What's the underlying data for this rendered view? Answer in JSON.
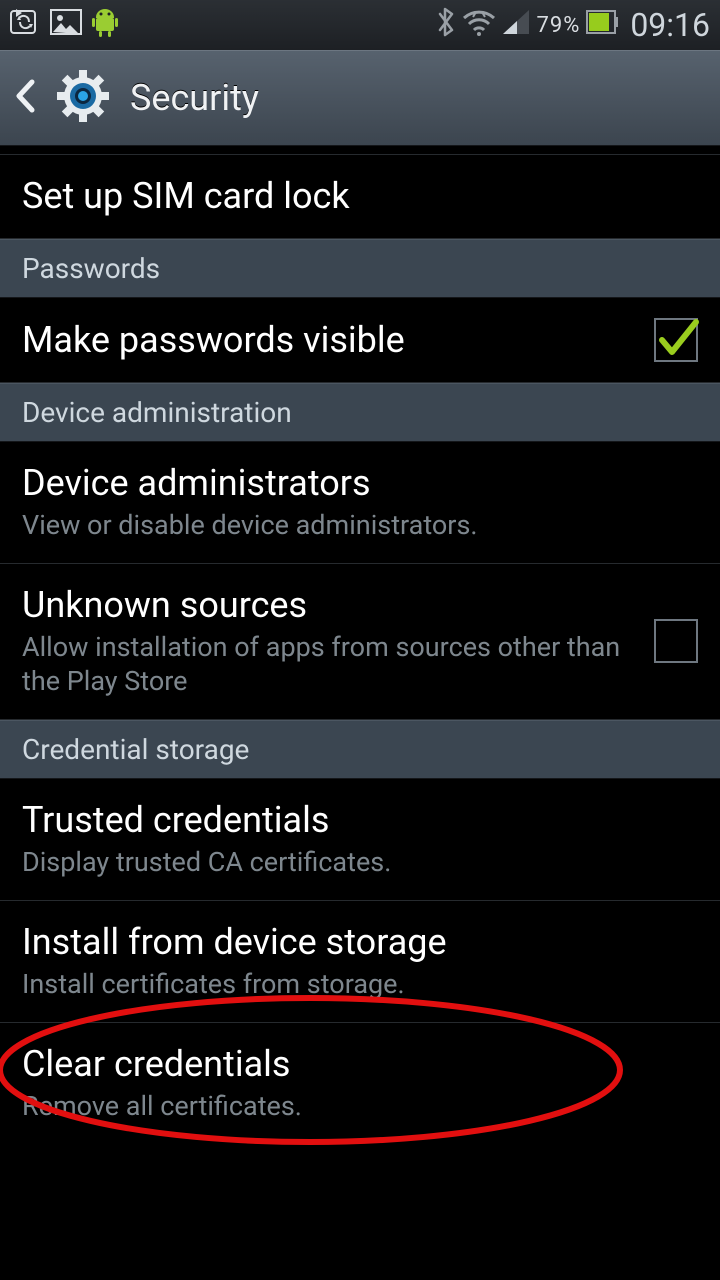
{
  "status": {
    "battery_pct": "79%",
    "time": "09:16"
  },
  "header": {
    "title": "Security"
  },
  "items": {
    "sim_lock": {
      "title": "Set up SIM card lock"
    },
    "section_passwords": "Passwords",
    "pw_visible": {
      "title": "Make passwords visible",
      "checked": true
    },
    "section_device_admin": "Device administration",
    "device_admins": {
      "title": "Device administrators",
      "sub": "View or disable device administrators."
    },
    "unknown_sources": {
      "title": "Unknown sources",
      "sub": "Allow installation of apps from sources other than the Play Store",
      "checked": false
    },
    "section_cred_storage": "Credential storage",
    "trusted_creds": {
      "title": "Trusted credentials",
      "sub": "Display trusted CA certificates."
    },
    "install_storage": {
      "title": "Install from device storage",
      "sub": "Install certificates from storage."
    },
    "clear_creds": {
      "title": "Clear credentials",
      "sub": "Remove all certificates."
    }
  }
}
